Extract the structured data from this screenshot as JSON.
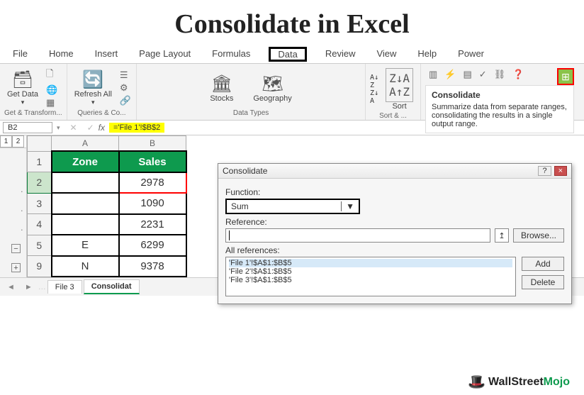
{
  "title": "Consolidate in Excel",
  "tabs": [
    "File",
    "Home",
    "Insert",
    "Page Layout",
    "Formulas",
    "Data",
    "Review",
    "View",
    "Help",
    "Power"
  ],
  "ribbon": {
    "get_data": "Get Data",
    "get_transform": "Get & Transform...",
    "refresh": "Refresh All",
    "queries": "Queries & Co...",
    "stocks": "Stocks",
    "geography": "Geography",
    "data_types": "Data Types",
    "sort": "Sort",
    "sort_filter": "Sort & ..."
  },
  "tooltip": {
    "title": "Consolidate",
    "body": "Summarize data from separate ranges, consolidating the results in a single output range."
  },
  "formula_bar": {
    "name_box": "B2",
    "formula": "='File 1'!$B$2"
  },
  "outline": {
    "levels": [
      "1",
      "2"
    ],
    "btn_minus": "−",
    "btn_plus": "+"
  },
  "grid": {
    "cols": [
      "A",
      "B"
    ],
    "headers": [
      "Zone",
      "Sales"
    ],
    "rows": [
      {
        "n": "2",
        "zone": "",
        "sales": "2978",
        "sel": true
      },
      {
        "n": "3",
        "zone": "",
        "sales": "1090"
      },
      {
        "n": "4",
        "zone": "",
        "sales": "2231"
      },
      {
        "n": "5",
        "zone": "E",
        "sales": "6299"
      },
      {
        "n": "9",
        "zone": "N",
        "sales": "9378"
      }
    ]
  },
  "sheet_tabs": {
    "other": "File 3",
    "active": "Consolidat"
  },
  "dialog": {
    "title": "Consolidate",
    "func_label": "Function:",
    "func_val": "Sum",
    "ref_label": "Reference:",
    "browse": "Browse...",
    "all_ref": "All references:",
    "refs": [
      "'File 1'!$A$1:$B$5",
      "'File 2'!$A$1:$B$5",
      "'File 3'!$A$1:$B$5"
    ],
    "add": "Add",
    "delete": "Delete",
    "help": "?",
    "close": "×"
  },
  "brand": {
    "a": "WallStreet",
    "b": "Mojo"
  }
}
